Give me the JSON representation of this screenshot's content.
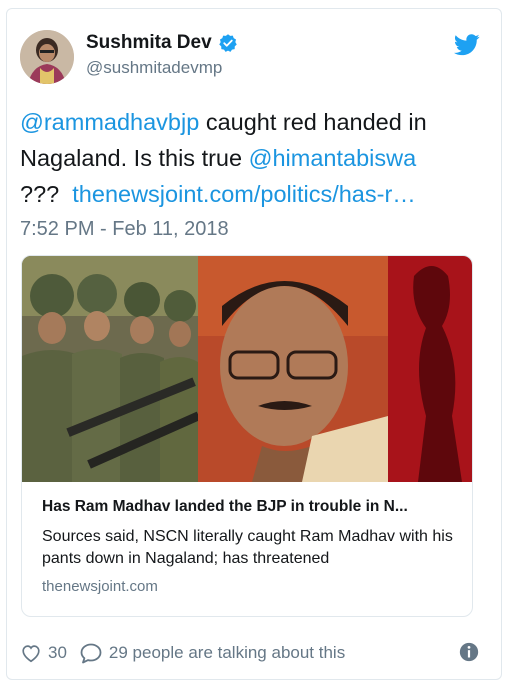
{
  "author": {
    "display_name": "Sushmita Dev",
    "handle": "@sushmitadevmp"
  },
  "tweet": {
    "line1_mention": "@rammadhavbjp",
    "line1_text": " caught red handed in",
    "line2_text": "Nagaland. Is this true ",
    "line2_mention": "@himantabiswa",
    "line3_text": "???  ",
    "line3_link": "thenewsjoint.com/politics/has-r…",
    "timestamp": "7:52 PM - Feb 11, 2018"
  },
  "card": {
    "title": "Has Ram Madhav landed the BJP in trouble in N...",
    "description": "Sources said, NSCN literally caught Ram Madhav with his pants down in Nagaland; has threatened",
    "domain": "thenewsjoint.com"
  },
  "actions": {
    "like_count": "30",
    "talking_text": "29 people are talking about this"
  },
  "icons": [
    "verified-badge-icon",
    "twitter-bird-icon",
    "heart-icon",
    "speech-bubble-icon",
    "info-icon"
  ],
  "colors": {
    "link": "#1b95e0",
    "secondary_text": "#657786",
    "verified": "#1da1f2",
    "twitter_brand": "#1da1f2"
  }
}
